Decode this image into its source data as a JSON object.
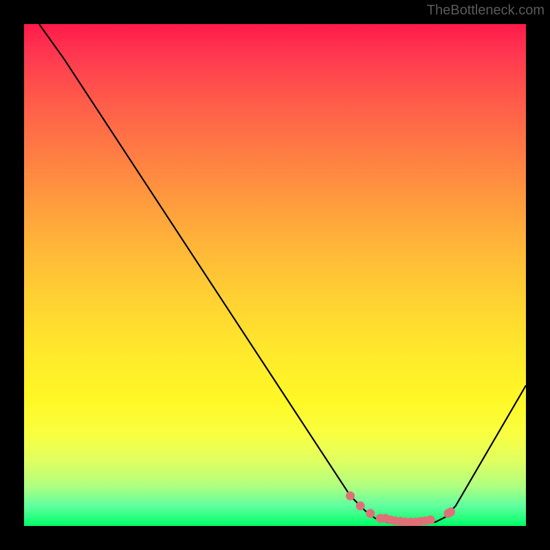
{
  "watermark": "TheBottleneck.com",
  "chart_data": {
    "type": "line",
    "title": "",
    "xlabel": "",
    "ylabel": "",
    "xlim": [
      0,
      100
    ],
    "ylim": [
      0,
      100
    ],
    "series": [
      {
        "name": "bottleneck-curve",
        "x": [
          3,
          8,
          65,
          68,
          70,
          72,
          74,
          76,
          78,
          80,
          82,
          84,
          86,
          100
        ],
        "y": [
          100,
          93,
          6,
          3,
          1.5,
          0.8,
          0.4,
          0.3,
          0.3,
          0.4,
          0.8,
          1.8,
          4,
          28
        ]
      }
    ],
    "markers": {
      "name": "optimal-zone",
      "color": "#e07078",
      "points": [
        {
          "x": 65,
          "y": 6
        },
        {
          "x": 67,
          "y": 4
        },
        {
          "x": 69,
          "y": 2.5
        },
        {
          "x": 71,
          "y": 1.5
        },
        {
          "x": 72,
          "y": 1.5
        },
        {
          "x": 73,
          "y": 1.2
        },
        {
          "x": 74,
          "y": 1.0
        },
        {
          "x": 75,
          "y": 0.9
        },
        {
          "x": 76,
          "y": 0.8
        },
        {
          "x": 77,
          "y": 0.8
        },
        {
          "x": 78,
          "y": 0.8
        },
        {
          "x": 79,
          "y": 0.9
        },
        {
          "x": 80,
          "y": 1.0
        },
        {
          "x": 81,
          "y": 1.2
        },
        {
          "x": 84.5,
          "y": 2.5
        },
        {
          "x": 85,
          "y": 2.8
        }
      ]
    },
    "gradient_stops": [
      {
        "pos": 0,
        "color": "#ff1a4a"
      },
      {
        "pos": 50,
        "color": "#ffd232"
      },
      {
        "pos": 100,
        "color": "#00ff66"
      }
    ]
  }
}
